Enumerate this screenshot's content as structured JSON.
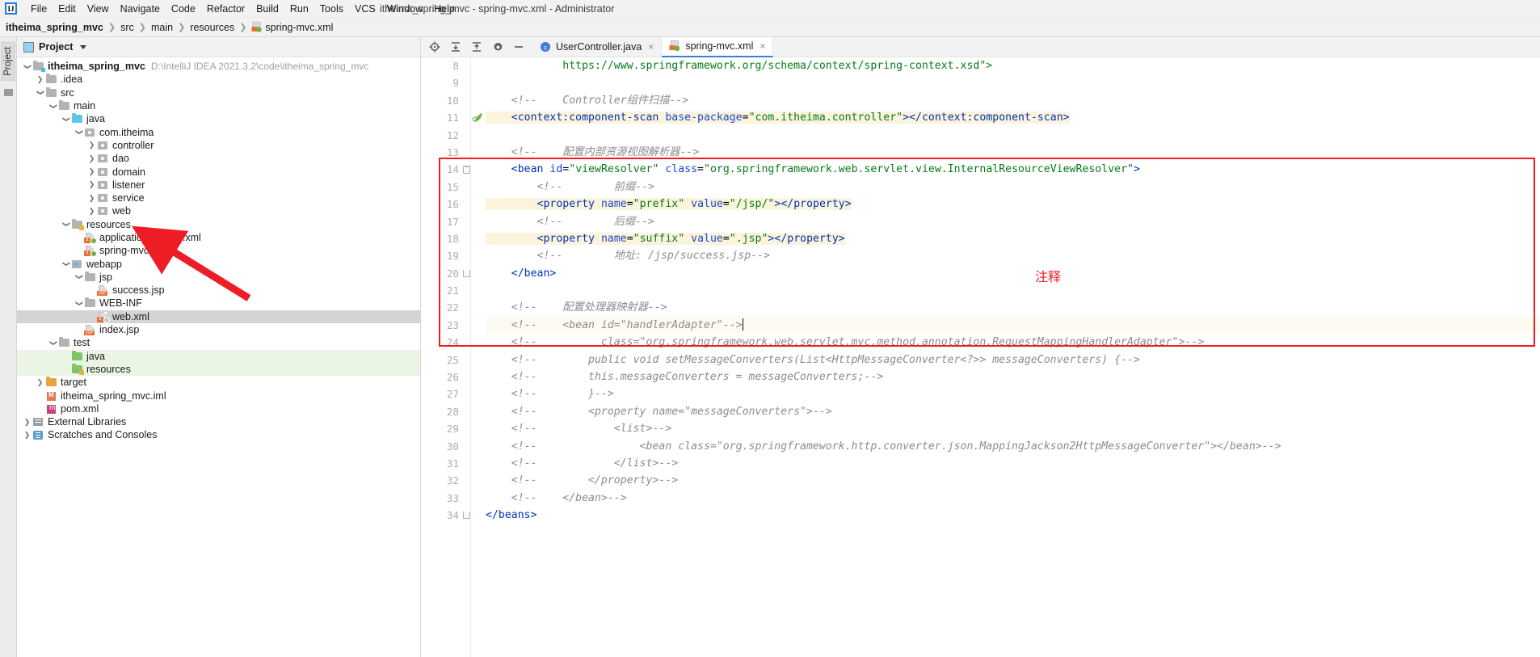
{
  "titlebar": {
    "logo": "IJ",
    "menus": [
      "File",
      "Edit",
      "View",
      "Navigate",
      "Code",
      "Refactor",
      "Build",
      "Run",
      "Tools",
      "VCS",
      "Window",
      "Help"
    ],
    "window_title": "itheima_spring_mvc - spring-mvc.xml - Administrator"
  },
  "breadcrumb": {
    "items": [
      "itheima_spring_mvc",
      "src",
      "main",
      "resources",
      "spring-mvc.xml"
    ]
  },
  "tool_strip": {
    "project_tab": "Project"
  },
  "project_panel": {
    "title": "Project",
    "root_label": "itheima_spring_mvc",
    "root_path": "D:\\IntelliJ IDEA 2021.3.2\\code\\itheima_spring_mvc",
    "nodes": [
      {
        "label": ".idea",
        "indent": 1,
        "icon": "folder-grey",
        "arrow": "right",
        "state": "normal"
      },
      {
        "label": "src",
        "indent": 1,
        "icon": "folder-grey",
        "arrow": "down",
        "state": "normal"
      },
      {
        "label": "main",
        "indent": 2,
        "icon": "folder-grey",
        "arrow": "down",
        "state": "normal"
      },
      {
        "label": "java",
        "indent": 3,
        "icon": "folder-source",
        "arrow": "down",
        "state": "normal"
      },
      {
        "label": "com.itheima",
        "indent": 4,
        "icon": "package",
        "arrow": "down",
        "state": "normal"
      },
      {
        "label": "controller",
        "indent": 5,
        "icon": "package",
        "arrow": "right",
        "state": "normal"
      },
      {
        "label": "dao",
        "indent": 5,
        "icon": "package",
        "arrow": "right",
        "state": "normal"
      },
      {
        "label": "domain",
        "indent": 5,
        "icon": "package",
        "arrow": "right",
        "state": "normal"
      },
      {
        "label": "listener",
        "indent": 5,
        "icon": "package",
        "arrow": "right",
        "state": "normal"
      },
      {
        "label": "service",
        "indent": 5,
        "icon": "package",
        "arrow": "right",
        "state": "normal"
      },
      {
        "label": "web",
        "indent": 5,
        "icon": "package",
        "arrow": "right",
        "state": "normal"
      },
      {
        "label": "resources",
        "indent": 3,
        "icon": "folder-resource",
        "arrow": "down",
        "state": "normal"
      },
      {
        "label": "applicationContext.xml",
        "indent": 4,
        "icon": "xml-spring",
        "arrow": "none",
        "state": "normal"
      },
      {
        "label": "spring-mvc.xml",
        "indent": 4,
        "icon": "xml-spring",
        "arrow": "none",
        "state": "normal"
      },
      {
        "label": "webapp",
        "indent": 3,
        "icon": "folder-web",
        "arrow": "down",
        "state": "normal"
      },
      {
        "label": "jsp",
        "indent": 4,
        "icon": "folder-grey",
        "arrow": "down",
        "state": "normal"
      },
      {
        "label": "success.jsp",
        "indent": 5,
        "icon": "jsp",
        "arrow": "none",
        "state": "normal"
      },
      {
        "label": "WEB-INF",
        "indent": 4,
        "icon": "folder-grey",
        "arrow": "down",
        "state": "normal"
      },
      {
        "label": "web.xml",
        "indent": 5,
        "icon": "xml-grey",
        "arrow": "none",
        "state": "selected"
      },
      {
        "label": "index.jsp",
        "indent": 4,
        "icon": "jsp",
        "arrow": "none",
        "state": "normal"
      },
      {
        "label": "test",
        "indent": 2,
        "icon": "folder-grey",
        "arrow": "down",
        "state": "normal"
      },
      {
        "label": "java",
        "indent": 3,
        "icon": "folder-test",
        "arrow": "none",
        "state": "green"
      },
      {
        "label": "resources",
        "indent": 3,
        "icon": "folder-testres",
        "arrow": "none",
        "state": "green"
      },
      {
        "label": "target",
        "indent": 1,
        "icon": "folder-target",
        "arrow": "right",
        "state": "normal"
      },
      {
        "label": "itheima_spring_mvc.iml",
        "indent": 1,
        "icon": "iml",
        "arrow": "none",
        "state": "normal"
      },
      {
        "label": "pom.xml",
        "indent": 1,
        "icon": "maven",
        "arrow": "none",
        "state": "normal"
      },
      {
        "label": "External Libraries",
        "indent": 0,
        "icon": "libraries",
        "arrow": "right",
        "state": "normal"
      },
      {
        "label": "Scratches and Consoles",
        "indent": 0,
        "icon": "scratches",
        "arrow": "right",
        "state": "normal"
      }
    ]
  },
  "editor": {
    "toolbar_icons": [
      "locate-icon",
      "expand-all-icon",
      "collapse-all-icon",
      "gear-icon",
      "hide-icon"
    ],
    "tabs": [
      {
        "label": "UserController.java",
        "icon": "java-class-icon",
        "active": false
      },
      {
        "label": "spring-mvc.xml",
        "icon": "xml-spring-icon",
        "active": true
      }
    ],
    "first_visible_line": 8,
    "lines": [
      {
        "n": 8,
        "segments": [
          {
            "t": "            ",
            "c": "plain"
          },
          {
            "t": "https://www.springframework.org/schema/context/spring-context.xsd\">",
            "c": "str"
          }
        ],
        "clipped_top": true
      },
      {
        "n": 9,
        "segments": []
      },
      {
        "n": 10,
        "segments": [
          {
            "t": "    ",
            "c": "plain"
          },
          {
            "t": "<!--    Controller组件扫描-->",
            "c": "cmt"
          }
        ]
      },
      {
        "n": 11,
        "highlight": "yellow",
        "gutter_icon": "spring-bean-icon",
        "segments": [
          {
            "t": "    ",
            "c": "plain"
          },
          {
            "t": "<context:component-scan",
            "c": "tag"
          },
          {
            "t": " base-package",
            "c": "attr"
          },
          {
            "t": "=",
            "c": "plain"
          },
          {
            "t": "\"com.itheima.controller\"",
            "c": "str"
          },
          {
            "t": ">",
            "c": "tag"
          },
          {
            "t": "</context:component-scan>",
            "c": "tag"
          }
        ]
      },
      {
        "n": 12,
        "segments": []
      },
      {
        "n": 13,
        "segments": [
          {
            "t": "    ",
            "c": "plain"
          },
          {
            "t": "<!--    配置内部资源视图解析器-->",
            "c": "cmt"
          }
        ]
      },
      {
        "n": 14,
        "fold": "start",
        "segments": [
          {
            "t": "    ",
            "c": "plain"
          },
          {
            "t": "<bean",
            "c": "tag"
          },
          {
            "t": " id",
            "c": "attr"
          },
          {
            "t": "=",
            "c": "plain"
          },
          {
            "t": "\"viewResolver\"",
            "c": "str"
          },
          {
            "t": " class",
            "c": "attr"
          },
          {
            "t": "=",
            "c": "plain"
          },
          {
            "t": "\"org.springframework.web.servlet.view.InternalResourceViewResolver\"",
            "c": "str"
          },
          {
            "t": ">",
            "c": "tag"
          }
        ]
      },
      {
        "n": 15,
        "segments": [
          {
            "t": "        ",
            "c": "plain"
          },
          {
            "t": "<!--        前缀-->",
            "c": "cmt"
          }
        ]
      },
      {
        "n": 16,
        "highlight": "yellow",
        "segments": [
          {
            "t": "        ",
            "c": "plain"
          },
          {
            "t": "<property",
            "c": "tag"
          },
          {
            "t": " name",
            "c": "attr"
          },
          {
            "t": "=",
            "c": "plain"
          },
          {
            "t": "\"prefix\"",
            "c": "str"
          },
          {
            "t": " value",
            "c": "attr"
          },
          {
            "t": "=",
            "c": "plain"
          },
          {
            "t": "\"/jsp/\"",
            "c": "str"
          },
          {
            "t": ">",
            "c": "tag"
          },
          {
            "t": "</property>",
            "c": "tag"
          }
        ]
      },
      {
        "n": 17,
        "segments": [
          {
            "t": "        ",
            "c": "plain"
          },
          {
            "t": "<!--        后缀-->",
            "c": "cmt"
          }
        ]
      },
      {
        "n": 18,
        "highlight": "yellow",
        "segments": [
          {
            "t": "        ",
            "c": "plain"
          },
          {
            "t": "<property",
            "c": "tag"
          },
          {
            "t": " name",
            "c": "attr"
          },
          {
            "t": "=",
            "c": "plain"
          },
          {
            "t": "\"suffix\"",
            "c": "str"
          },
          {
            "t": " value",
            "c": "attr"
          },
          {
            "t": "=",
            "c": "plain"
          },
          {
            "t": "\".jsp\"",
            "c": "str"
          },
          {
            "t": ">",
            "c": "tag"
          },
          {
            "t": "</property>",
            "c": "tag"
          }
        ]
      },
      {
        "n": 19,
        "segments": [
          {
            "t": "        ",
            "c": "plain"
          },
          {
            "t": "<!--        地址: /jsp/success.jsp-->",
            "c": "cmt"
          }
        ]
      },
      {
        "n": 20,
        "fold": "end",
        "segments": [
          {
            "t": "    ",
            "c": "plain"
          },
          {
            "t": "</bean>",
            "c": "tag"
          }
        ]
      },
      {
        "n": 21,
        "segments": []
      },
      {
        "n": 22,
        "segments": [
          {
            "t": "    ",
            "c": "plain"
          },
          {
            "t": "<!--    配置处理器映射器-->",
            "c": "cmt"
          }
        ]
      },
      {
        "n": 23,
        "highlight": "row",
        "caret": true,
        "segments": [
          {
            "t": "    ",
            "c": "plain"
          },
          {
            "t": "<!--    <bean id=\"handlerAdapter\"-->",
            "c": "cmt"
          }
        ]
      },
      {
        "n": 24,
        "segments": [
          {
            "t": "    ",
            "c": "plain"
          },
          {
            "t": "<!--          class=\"org.springframework.web.servlet.mvc.method.annotation.RequestMappingHandlerAdapter\">-->",
            "c": "cmt"
          }
        ]
      },
      {
        "n": 25,
        "segments": [
          {
            "t": "    ",
            "c": "plain"
          },
          {
            "t": "<!--        public void setMessageConverters(List<HttpMessageConverter<?>> messageConverters) {-->",
            "c": "cmt"
          }
        ]
      },
      {
        "n": 26,
        "segments": [
          {
            "t": "    ",
            "c": "plain"
          },
          {
            "t": "<!--        this.messageConverters = messageConverters;-->",
            "c": "cmt"
          }
        ]
      },
      {
        "n": 27,
        "segments": [
          {
            "t": "    ",
            "c": "plain"
          },
          {
            "t": "<!--        }-->",
            "c": "cmt"
          }
        ]
      },
      {
        "n": 28,
        "segments": [
          {
            "t": "    ",
            "c": "plain"
          },
          {
            "t": "<!--        <property name=\"messageConverters\">-->",
            "c": "cmt"
          }
        ]
      },
      {
        "n": 29,
        "segments": [
          {
            "t": "    ",
            "c": "plain"
          },
          {
            "t": "<!--            <list>-->",
            "c": "cmt"
          }
        ]
      },
      {
        "n": 30,
        "segments": [
          {
            "t": "    ",
            "c": "plain"
          },
          {
            "t": "<!--                <bean class=\"org.springframework.http.converter.json.MappingJackson2HttpMessageConverter\"></bean>-->",
            "c": "cmt"
          }
        ]
      },
      {
        "n": 31,
        "segments": [
          {
            "t": "    ",
            "c": "plain"
          },
          {
            "t": "<!--            </list>-->",
            "c": "cmt"
          }
        ]
      },
      {
        "n": 32,
        "segments": [
          {
            "t": "    ",
            "c": "plain"
          },
          {
            "t": "<!--        </property>-->",
            "c": "cmt"
          }
        ]
      },
      {
        "n": 33,
        "segments": [
          {
            "t": "    ",
            "c": "plain"
          },
          {
            "t": "<!--    </bean>-->",
            "c": "cmt"
          }
        ]
      },
      {
        "n": 34,
        "fold": "end",
        "segments": [
          {
            "t": "</beans>",
            "c": "tag"
          }
        ]
      }
    ]
  },
  "annotations": {
    "note_label": "注释",
    "note_color": "#ee1c25",
    "box_color": "#ee1c25",
    "arrow_color": "#ee1c25",
    "arrow_target": "spring-mvc.xml"
  }
}
